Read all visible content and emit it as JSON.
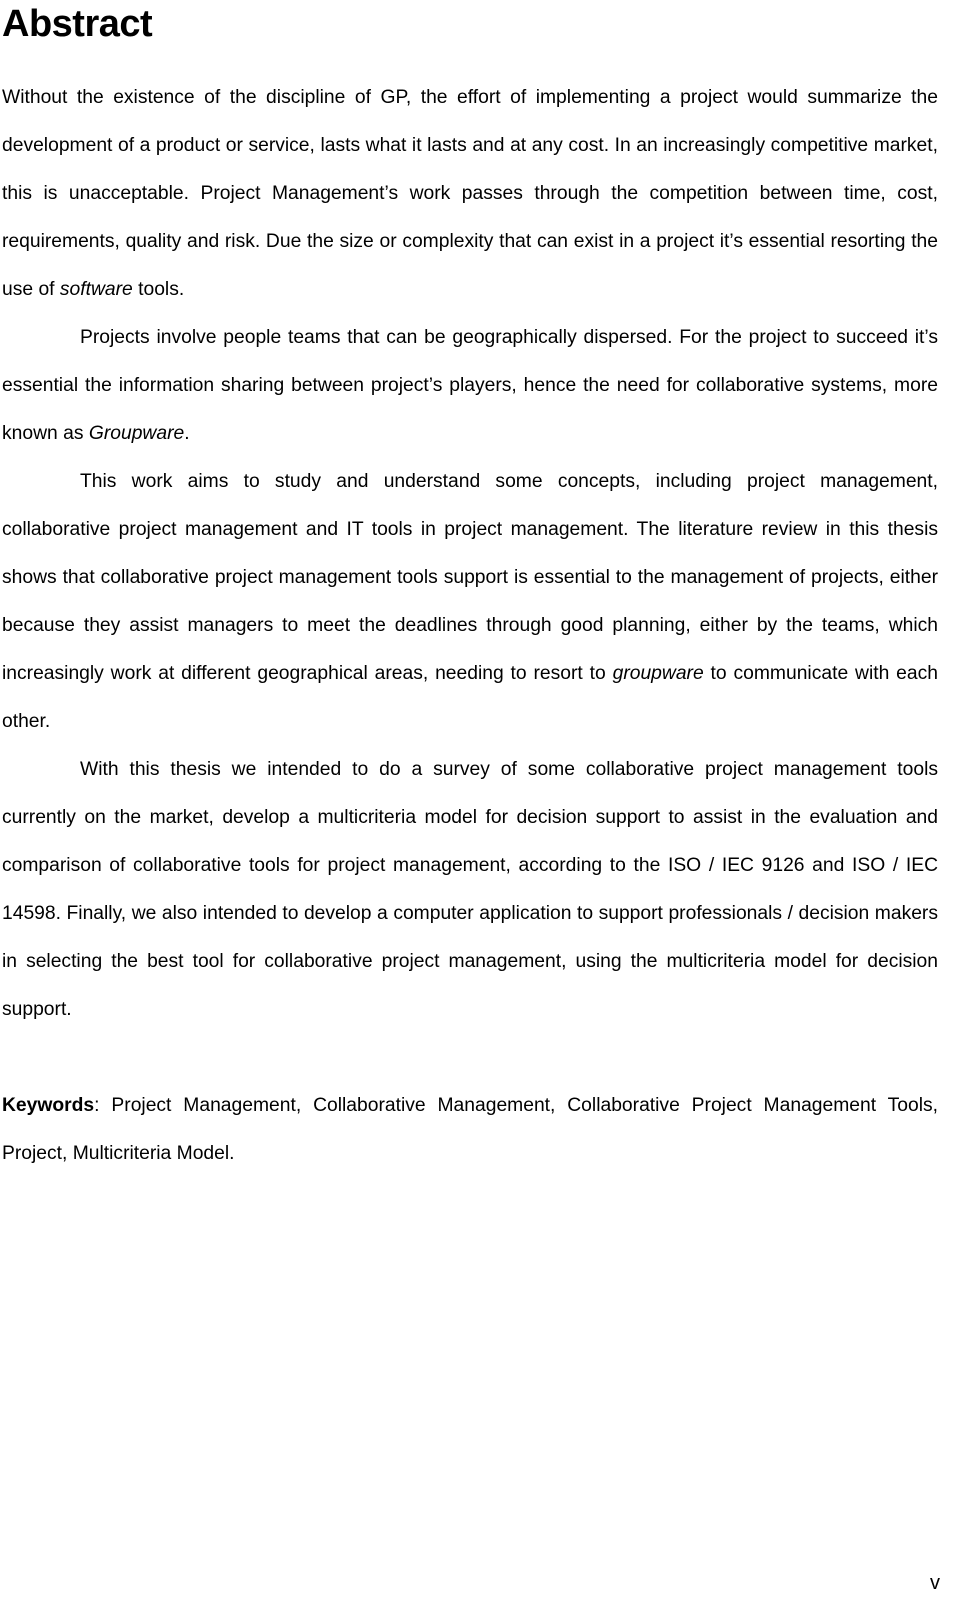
{
  "document": {
    "title": "Abstract",
    "page_number": "v",
    "keywords_label": "Keywords",
    "keywords_separator": ": "
  },
  "abstract": {
    "paragraphs": [
      {
        "id": "p1",
        "indented": false,
        "runs": [
          {
            "style": "normal",
            "text": "Without the existence of the discipline of GP, the effort of implementing a project would summarize the development of a product or service, lasts what it lasts and at any cost. In an increasingly competitive market, this is unacceptable. Project Management’s work passes through the competition between time, cost, requirements, quality and risk. Due the size or complexity that can exist in a project it’s essential resorting the use of "
          },
          {
            "style": "italic",
            "text": "software"
          },
          {
            "style": "normal",
            "text": " tools."
          }
        ]
      },
      {
        "id": "p2",
        "indented": true,
        "runs": [
          {
            "style": "normal",
            "text": "Projects involve people teams that can be geographically dispersed. For the project to succeed it’s essential the information sharing between project’s players, hence the need for collaborative systems, more known as "
          },
          {
            "style": "italic",
            "text": "Groupware"
          },
          {
            "style": "normal",
            "text": "."
          }
        ]
      },
      {
        "id": "p3",
        "indented": true,
        "runs": [
          {
            "style": "normal",
            "text": "This work aims to study and understand some concepts, including project management, collaborative project management and IT tools in project management. The literature review in this thesis shows that collaborative project management tools support is essential to the management of projects, either because they assist managers to meet the deadlines through good planning, either by the teams, which increasingly work at different geographical areas, needing to resort to "
          },
          {
            "style": "italic",
            "text": "groupware"
          },
          {
            "style": "normal",
            "text": " to communicate with each other."
          }
        ]
      },
      {
        "id": "p4",
        "indented": true,
        "runs": [
          {
            "style": "normal",
            "text": "With this thesis we intended to do a survey of some collaborative project management tools currently on the market, develop a multicriteria model for decision support to assist in the evaluation and comparison of collaborative tools for project management, according to the ISO / IEC 9126 and ISO / IEC 14598. Finally, we also intended to develop a computer application to support professionals / decision makers in selecting the best tool for collaborative project management, using the multicriteria model for decision support."
          }
        ]
      }
    ],
    "keywords_text": "Project Management, Collaborative Management, Collaborative Project Management Tools, Project, Multicriteria Model."
  }
}
